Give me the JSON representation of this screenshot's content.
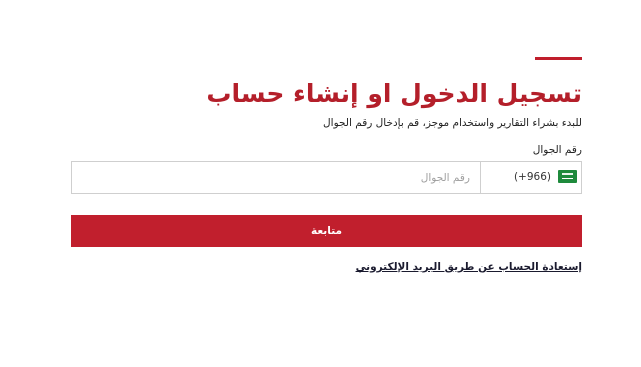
{
  "header": {
    "title": "تسجيل الدخول او إنشاء حساب",
    "subtitle": "للبدء بشراء التقارير واستخدام موجز، قم بإدخال رقم الجوال"
  },
  "form": {
    "phone_label": "رقم الجوال",
    "country": {
      "flag_icon": "saudi-arabia-flag-icon",
      "dial_code": "(+966)"
    },
    "phone_input": {
      "value": "",
      "placeholder": "رقم الجوال"
    },
    "continue_label": "متابعة",
    "recover_link_label": "إستعادة الحساب عن طريق البريد الإلكتروني"
  },
  "colors": {
    "accent": "#c01e2c",
    "title": "#b41f2a",
    "button": "#c11f2d",
    "flag_green": "#1e8a3c"
  }
}
